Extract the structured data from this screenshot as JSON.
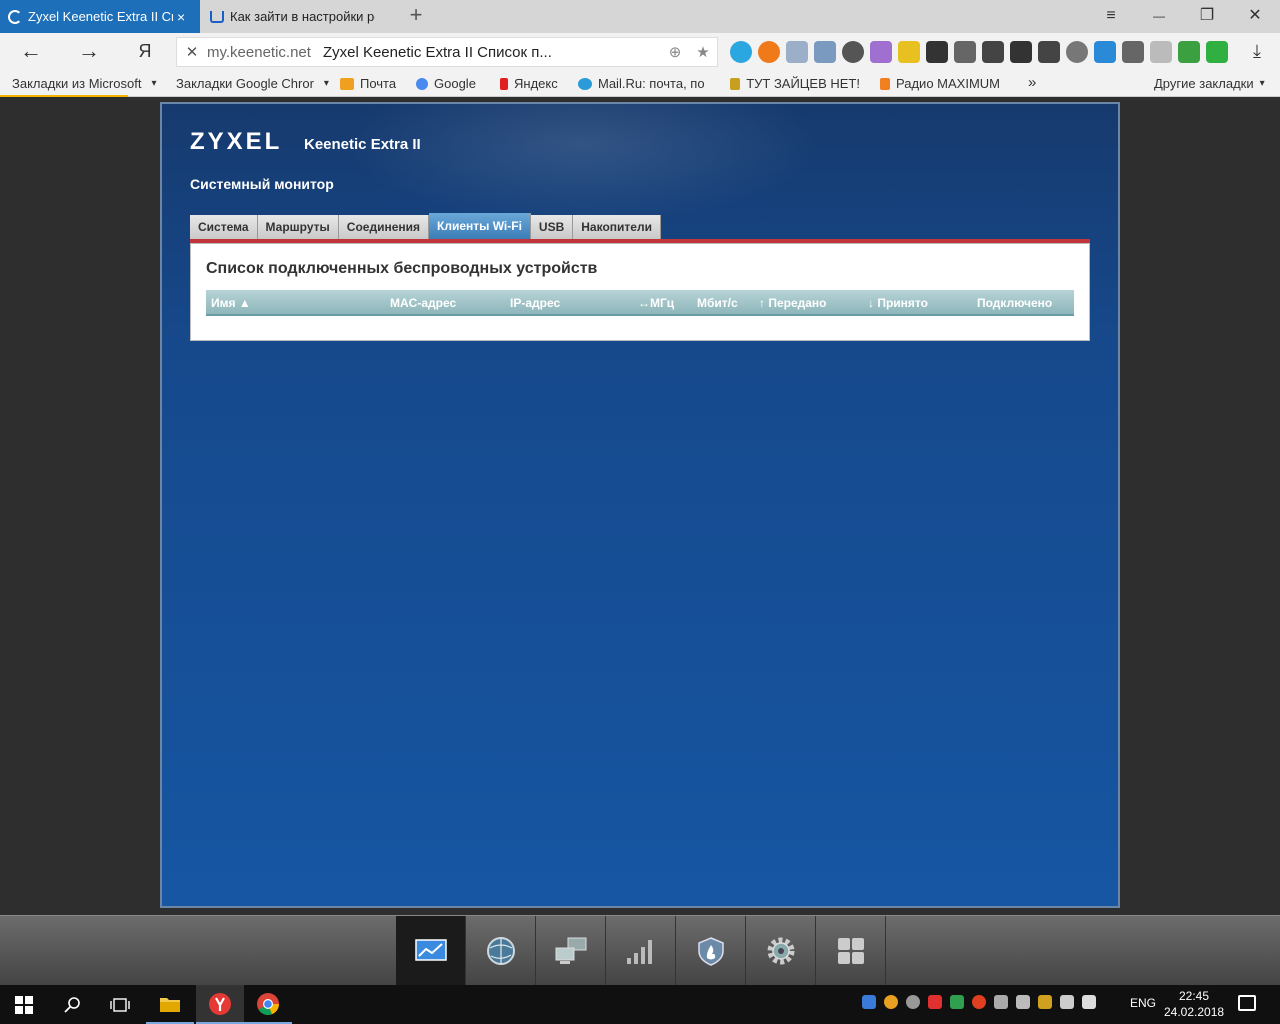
{
  "browser": {
    "tabs": [
      {
        "title": "Zyxel Keenetic Extra II Сп",
        "close": "×",
        "active": true
      },
      {
        "title": "Как зайти в настройки роу",
        "close": "",
        "active": false
      }
    ],
    "new_tab": "+",
    "window_controls": {
      "menu": "≡",
      "minimize": "—",
      "restore": "❐",
      "close": "✕"
    },
    "nav": {
      "back": "←",
      "forward": "→",
      "yandex": "Я"
    },
    "omnibox": {
      "stop": "✕",
      "host": "my.keenetic.net",
      "title": "Zyxel Keenetic Extra II Список п...",
      "bookmark_star": "★"
    },
    "download": "⤓",
    "bookmarks": [
      {
        "label": "Закладки из Microsoft",
        "caret": "▾"
      },
      {
        "label": "Закладки Google Chror",
        "caret": "▾"
      },
      {
        "label": "Почта"
      },
      {
        "label": "Google"
      },
      {
        "label": "Яндекс"
      },
      {
        "label": "Mail.Ru: почта, по"
      },
      {
        "label": "ТУТ ЗАЙЦЕВ НЕТ!"
      },
      {
        "label": "Радио MAXIMUM"
      },
      {
        "label": "»"
      },
      {
        "label": "Другие закладки",
        "caret": "▾"
      }
    ]
  },
  "router": {
    "brand": "ZYXEL",
    "model": "Keenetic Extra II",
    "page_title": "Системный монитор",
    "tabs": [
      "Система",
      "Маршруты",
      "Соединения",
      "Клиенты Wi-Fi",
      "USB",
      "Накопители"
    ],
    "active_tab": "Клиенты Wi-Fi",
    "section_title": "Список подключенных беспроводных устройств",
    "columns": [
      "Имя ▲",
      "MAC-адрес",
      "IP-адрес",
      "↔МГц",
      "Мбит/с",
      "↑ Передано",
      "↓ Принято",
      "Подключено"
    ]
  },
  "dock": {
    "buttons": [
      "monitor-icon",
      "globe-icon",
      "network-icon",
      "wifi-signal-icon",
      "shield-icon",
      "gear-icon",
      "apps-icon"
    ],
    "active": "monitor-icon"
  },
  "taskbar": {
    "lang": "ENG",
    "time": "22:45",
    "date": "24.02.2018"
  },
  "colors": {
    "router_bg": "#1656a3",
    "accent_red": "#c0343a",
    "active_tab": "#3c7db8",
    "browser_active_tab": "#1c6fb8"
  }
}
